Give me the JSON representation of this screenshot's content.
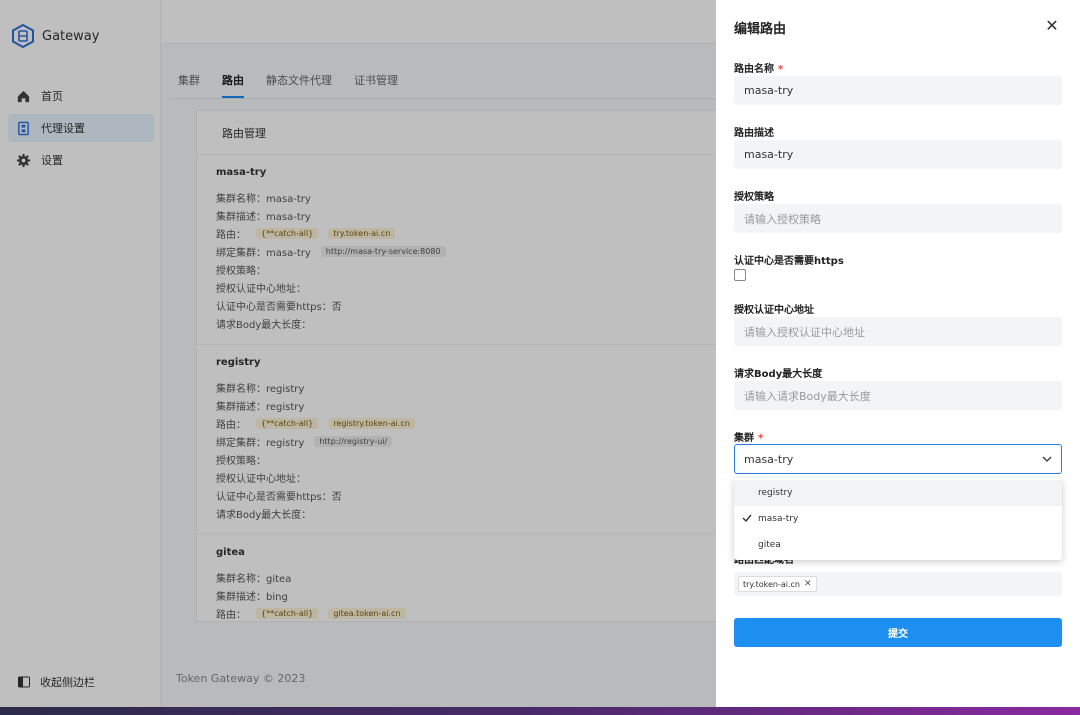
{
  "brand": {
    "name": "Gateway"
  },
  "sidebar": {
    "items": [
      {
        "label": "首页"
      },
      {
        "label": "代理设置"
      },
      {
        "label": "设置"
      }
    ],
    "collapse_label": "收起侧边栏"
  },
  "tabs": [
    "集群",
    "路由",
    "静态文件代理",
    "证书管理"
  ],
  "card": {
    "title": "路由管理",
    "routes": [
      {
        "name": "masa-try",
        "cluster_name": "集群名称：masa-try",
        "cluster_desc": "集群描述：masa-try",
        "route_label": "路由：",
        "route_tags": [
          "{**catch-all}",
          "try.token-ai.cn"
        ],
        "bind_label": "绑定集群：masa-try",
        "bind_tag": "http://masa-try-service:8080",
        "auth_policy": "授权策略：",
        "auth_url": "授权认证中心地址：",
        "https": "认证中心是否需要https：否",
        "body_len": "请求Body最大长度："
      },
      {
        "name": "registry",
        "cluster_name": "集群名称：registry",
        "cluster_desc": "集群描述：registry",
        "route_label": "路由：",
        "route_tags": [
          "{**catch-all}",
          "registry.token-ai.cn"
        ],
        "bind_label": "绑定集群：registry",
        "bind_tag": "http://registry-ui/",
        "auth_policy": "授权策略：",
        "auth_url": "授权认证中心地址：",
        "https": "认证中心是否需要https：否",
        "body_len": "请求Body最大长度："
      },
      {
        "name": "gitea",
        "cluster_name": "集群名称：gitea",
        "cluster_desc": "集群描述：bing",
        "route_label": "路由：",
        "route_tags": [
          "{**catch-all}",
          "gitea.token-ai.cn"
        ]
      }
    ]
  },
  "footer": "Token Gateway © 2023",
  "drawer": {
    "title": "编辑路由",
    "route_name_label": "路由名称",
    "route_name_value": "masa-try",
    "route_desc_label": "路由描述",
    "route_desc_value": "masa-try",
    "auth_policy_label": "授权策略",
    "auth_policy_placeholder": "请输入授权策略",
    "https_label": "认证中心是否需要https",
    "auth_url_label": "授权认证中心地址",
    "auth_url_placeholder": "请输入授权认证中心地址",
    "body_len_label": "请求Body最大长度",
    "body_len_placeholder": "请输入请求Body最大长度",
    "cluster_label": "集群",
    "cluster_value": "masa-try",
    "cluster_options": [
      "registry",
      "masa-try",
      "gitea"
    ],
    "domain_label": "路由匹配域名",
    "domain_chip": "try.token-ai.cn",
    "submit_label": "提交"
  },
  "colors": {
    "accent": "#1d8ff0",
    "required": "#e8473a"
  }
}
